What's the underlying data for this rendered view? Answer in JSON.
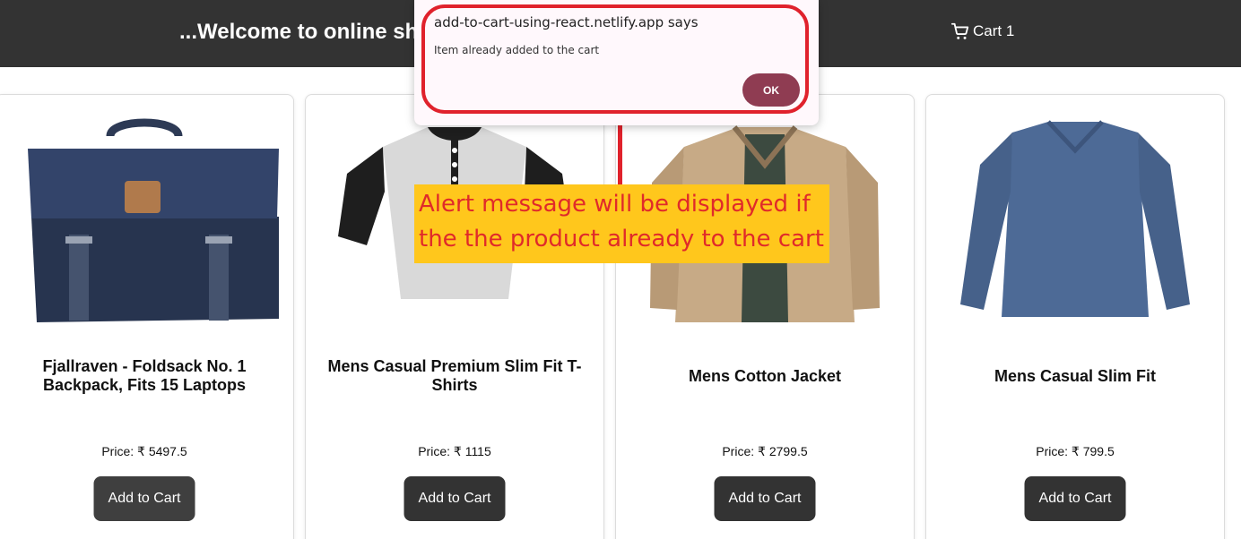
{
  "header": {
    "title": "...Welcome to online shop",
    "cart_label": "Cart 1",
    "background": "#333333"
  },
  "products": [
    {
      "name": "Fjallraven - Foldsack No. 1 Backpack, Fits 15 Laptops",
      "price": "Price: ₹ 5497.5",
      "button": "Add to Cart"
    },
    {
      "name": "Mens Casual Premium Slim Fit T-Shirts",
      "price": "Price: ₹ 1115",
      "button": "Add to Cart"
    },
    {
      "name": "Mens Cotton Jacket",
      "price": "Price: ₹ 2799.5",
      "button": "Add to Cart"
    },
    {
      "name": "Mens Casual Slim Fit",
      "price": "Price: ₹ 799.5",
      "button": "Add to Cart"
    }
  ],
  "dialog": {
    "title": "add-to-cart-using-react.netlify.app says",
    "message": "Item already added to the cart",
    "ok_label": "OK",
    "accent": "#8f3c52"
  },
  "annotation": {
    "text": "Alert message will be displayed if the the product already to the cart",
    "background": "#ffc71c",
    "color": "#e02a2a"
  },
  "icons": {
    "cart": "shopping-cart-icon"
  }
}
